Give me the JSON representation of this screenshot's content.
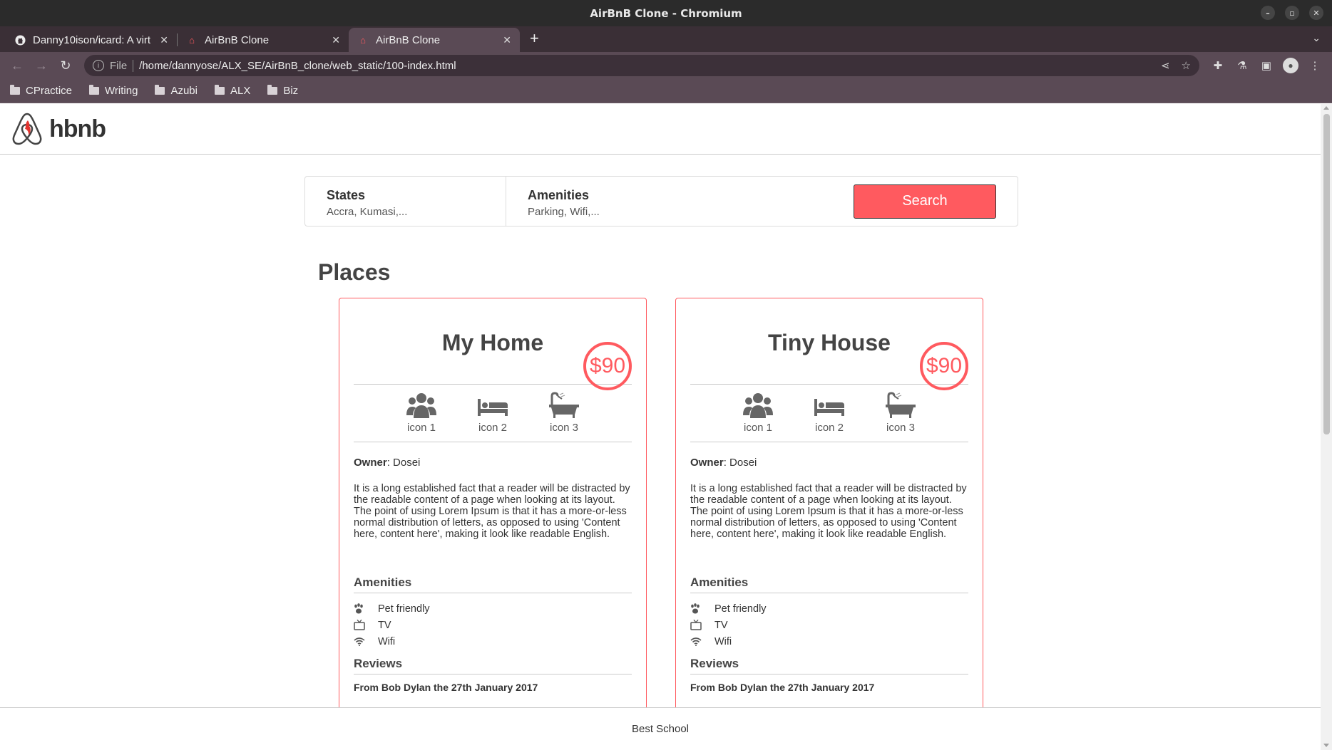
{
  "window": {
    "title": "AirBnB Clone - Chromium"
  },
  "tabs": [
    {
      "label": "Danny10ison/icard: A virt",
      "icon": "github-icon",
      "active": false
    },
    {
      "label": "AirBnB Clone",
      "icon": "airbnb-favicon",
      "active": false
    },
    {
      "label": "AirBnB Clone",
      "icon": "airbnb-favicon",
      "active": true
    }
  ],
  "toolbar": {
    "scheme": "File",
    "url": "/home/dannyose/ALX_SE/AirBnB_clone/web_static/100-index.html"
  },
  "bookmarks": [
    "CPractice",
    "Writing",
    "Azubi",
    "ALX",
    "Biz"
  ],
  "site": {
    "brand": "hbnb",
    "accent": "#ff5a5f",
    "filters": {
      "states_title": "States",
      "states_value": "Accra, Kumasi,...",
      "amenities_title": "Amenities",
      "amenities_value": "Parking, Wifi,...",
      "search_label": "Search"
    },
    "places_title": "Places",
    "places": [
      {
        "name": "My Home",
        "price": "$90",
        "info": [
          "icon 1",
          "icon 2",
          "icon 3"
        ],
        "owner_label": "Owner",
        "owner": ": Dosei",
        "description": "It is a long established fact that a reader will be distracted by the readable content of a page when looking at its layout. The point of using Lorem Ipsum is that it has a more-or-less normal distribution of letters, as opposed to using 'Content here, content here', making it look like readable English.",
        "amenities_title": "Amenities",
        "amenities": [
          "Pet friendly",
          "TV",
          "Wifi"
        ],
        "reviews_title": "Reviews",
        "review_from": "From Bob Dylan the 27th January 2017"
      },
      {
        "name": "Tiny House",
        "price": "$90",
        "info": [
          "icon 1",
          "icon 2",
          "icon 3"
        ],
        "owner_label": "Owner",
        "owner": ": Dosei",
        "description": "It is a long established fact that a reader will be distracted by the readable content of a page when looking at its layout. The point of using Lorem Ipsum is that it has a more-or-less normal distribution of letters, as opposed to using 'Content here, content here', making it look like readable English.",
        "amenities_title": "Amenities",
        "amenities": [
          "Pet friendly",
          "TV",
          "Wifi"
        ],
        "reviews_title": "Reviews",
        "review_from": "From Bob Dylan the 27th January 2017"
      }
    ],
    "footer": "Best School"
  }
}
